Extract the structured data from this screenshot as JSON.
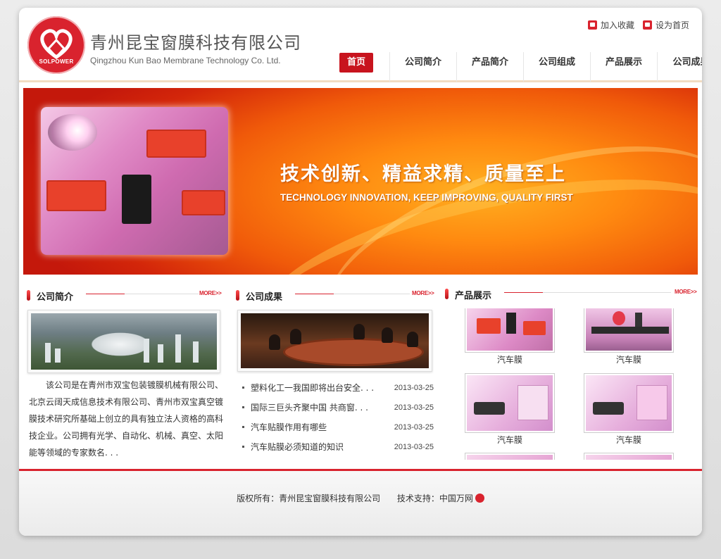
{
  "brand": {
    "logo_text": "SOLPOWER",
    "company_cn": "青州昆宝窗膜科技有限公司",
    "company_en": "Qingzhou Kun Bao Membrane Technology Co. Ltd.",
    "accent_color": "#c8141e"
  },
  "toplinks": {
    "favorite": "加入收藏",
    "homepage": "设为首页"
  },
  "nav": {
    "items": [
      {
        "label": "首页",
        "active": true
      },
      {
        "label": "公司简介"
      },
      {
        "label": "产品简介"
      },
      {
        "label": "公司组成"
      },
      {
        "label": "产品展示"
      },
      {
        "label": "公司成果"
      }
    ]
  },
  "banner": {
    "slogan_cn": "技术创新、精益求精、质量至上",
    "slogan_en": "TECHNOLOGY INNOVATION, KEEP IMPROVING, QUALITY FIRST"
  },
  "intro": {
    "title": "公司简介",
    "more": "MORE>>",
    "text": "该公司是在青州市双宝包装镀膜机械有限公司、北京云阔天成信息技术有限公司、青州市双宝真空镀膜技术研究所基础上创立的具有独立法人资格的高科技企业。公司拥有光学、自动化、机械、真空、太阳能等领域的专家数名. . ."
  },
  "achievements": {
    "title": "公司成果",
    "more": "MORE>>",
    "news": [
      {
        "title": "塑料化工一我国即将出台安全. . .",
        "date": "2013-03-25"
      },
      {
        "title": "国际三巨头齐聚中国 共商窗. . .",
        "date": "2013-03-25"
      },
      {
        "title": "汽车贴膜作用有哪些",
        "date": "2013-03-25"
      },
      {
        "title": "汽车贴膜必须知道的知识",
        "date": "2013-03-25"
      }
    ]
  },
  "products": {
    "title": "产品展示",
    "more": "MORE>>",
    "items": [
      {
        "label": "汽车膜"
      },
      {
        "label": "汽车膜"
      },
      {
        "label": "汽车膜"
      },
      {
        "label": "汽车膜"
      }
    ]
  },
  "footer": {
    "copyright": "版权所有：青州昆宝窗膜科技有限公司",
    "support": "技术支持：中国万网"
  }
}
